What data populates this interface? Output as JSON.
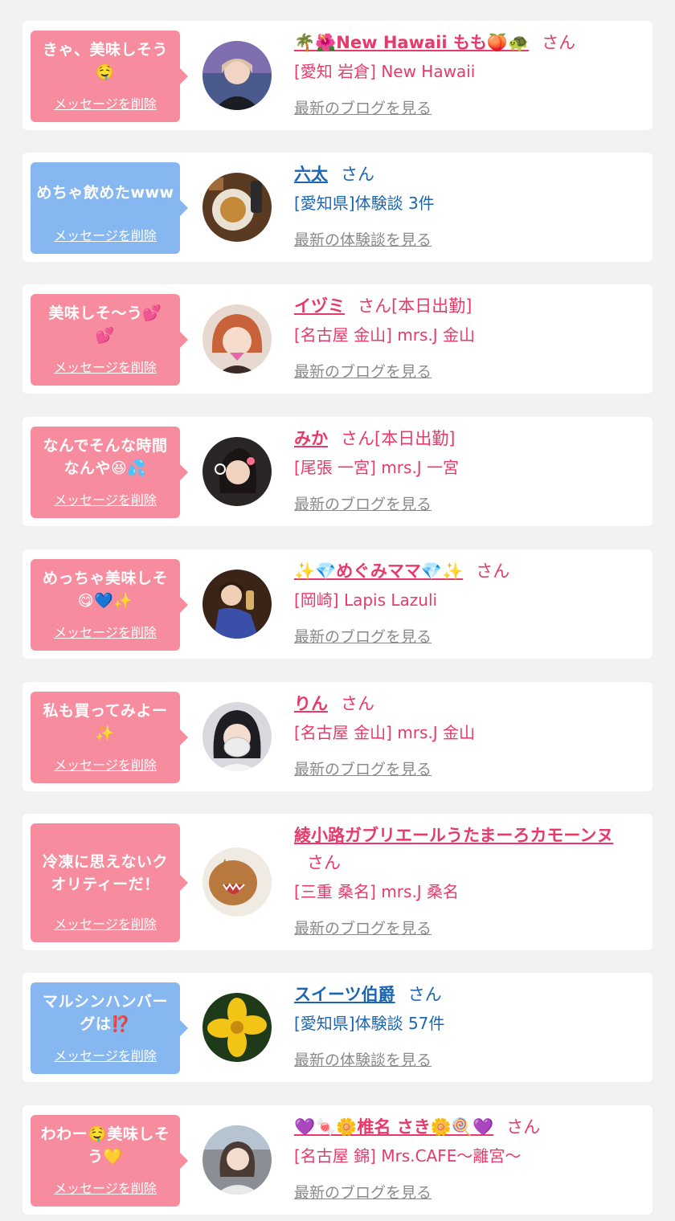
{
  "items": [
    {
      "message": "きゃ、美味しそう\n🤤",
      "delete_label": "メッセージを削除",
      "name": "🌴🌺New Hawaii もも🍑🐢",
      "honorific": "さん",
      "shop": "[愛知 岩倉] New Hawaii",
      "latest_label": "最新のブログを見る",
      "bubble_color": "#f78c9e",
      "name_color": "#e8396a",
      "avatar_icon": "avatar-photo"
    },
    {
      "message": "めちゃ飲めたwww",
      "delete_label": "メッセージを削除",
      "name": "六太",
      "honorific": "さん",
      "shop": "[愛知県]体験談 3件",
      "latest_label": "最新の体験談を見る",
      "bubble_color": "#86b7f0",
      "name_color": "#1a66b5",
      "avatar_icon": "avatar-photo"
    },
    {
      "message": "美味しそ〜う💕\n💕",
      "delete_label": "メッセージを削除",
      "name": "イヅミ",
      "honorific": "さん[本日出勤]",
      "shop": "[名古屋 金山] mrs.J 金山",
      "latest_label": "最新のブログを見る",
      "bubble_color": "#f78c9e",
      "name_color": "#e8396a",
      "avatar_icon": "avatar-photo"
    },
    {
      "message": "なんでそんな時間\nなんや😆💦",
      "delete_label": "メッセージを削除",
      "name": "みか",
      "honorific": "さん[本日出勤]",
      "shop": "[尾張 一宮] mrs.J 一宮",
      "latest_label": "最新のブログを見る",
      "bubble_color": "#f78c9e",
      "name_color": "#e8396a",
      "avatar_icon": "avatar-photo"
    },
    {
      "message": "めっちゃ美味しそ\n😋💙✨",
      "delete_label": "メッセージを削除",
      "name": "✨💎めぐみママ💎✨",
      "honorific": "さん",
      "shop": "[岡崎] Lapis Lazuli",
      "latest_label": "最新のブログを見る",
      "bubble_color": "#f78c9e",
      "name_color": "#e8396a",
      "avatar_icon": "avatar-photo"
    },
    {
      "message": "私も買ってみよー\n✨",
      "delete_label": "メッセージを削除",
      "name": "りん",
      "honorific": "さん",
      "shop": "[名古屋 金山] mrs.J 金山",
      "latest_label": "最新のブログを見る",
      "bubble_color": "#f78c9e",
      "name_color": "#e8396a",
      "avatar_icon": "avatar-photo"
    },
    {
      "message": "冷凍に思えないク\nオリティーだ！",
      "delete_label": "メッセージを削除",
      "name": "綾小路ガブリエールうたまーろカモーンヌ",
      "honorific": "さん",
      "shop": "[三重 桑名] mrs.J 桑名",
      "latest_label": "最新のブログを見る",
      "bubble_color": "#f78c9e",
      "name_color": "#e8396a",
      "avatar_icon": "avatar-photo"
    },
    {
      "message": "マルシンハンバー\nグは⁉️",
      "delete_label": "メッセージを削除",
      "name": "スイーツ伯爵",
      "honorific": "さん",
      "shop": "[愛知県]体験談 57件",
      "latest_label": "最新の体験談を見る",
      "bubble_color": "#86b7f0",
      "name_color": "#1a66b5",
      "avatar_icon": "avatar-photo"
    },
    {
      "message": "わわー🤤美味しそ\nう💛",
      "delete_label": "メッセージを削除",
      "name": "💜🍬🌼椎名 さき🌼🍭💜",
      "honorific": "さん",
      "shop": "[名古屋 錦] Mrs.CAFE〜離宮〜",
      "latest_label": "最新のブログを見る",
      "bubble_color": "#f78c9e",
      "name_color": "#e8396a",
      "avatar_icon": "avatar-photo"
    }
  ]
}
